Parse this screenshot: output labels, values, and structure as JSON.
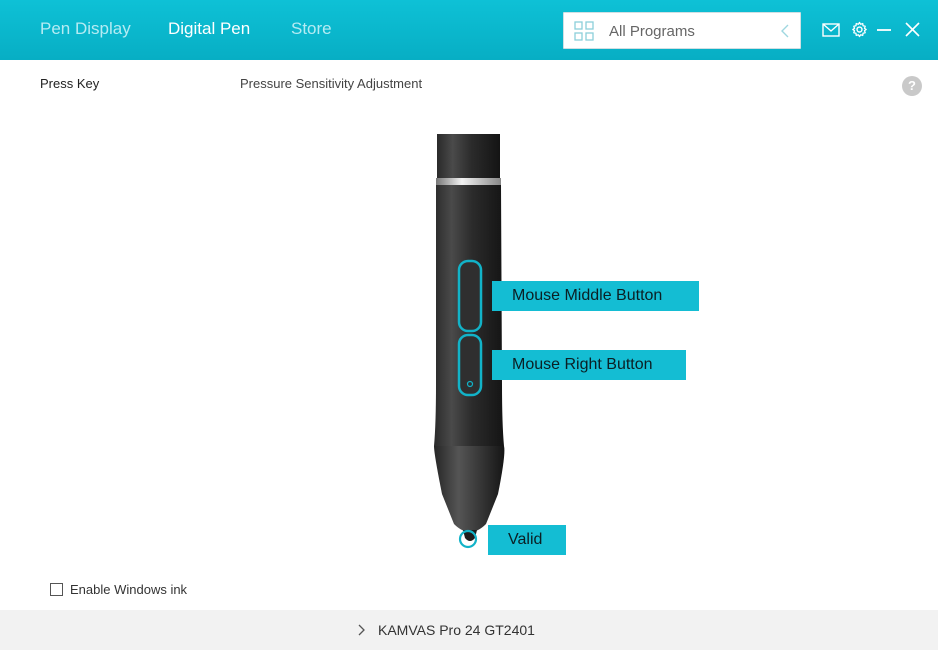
{
  "header": {
    "tabs": [
      {
        "label": "Pen Display",
        "active": false
      },
      {
        "label": "Digital Pen",
        "active": true
      },
      {
        "label": "Store",
        "active": false
      }
    ],
    "program_select": {
      "value": "All Programs"
    },
    "icons": [
      "mail-icon",
      "gear-icon",
      "minimize-icon",
      "close-icon"
    ]
  },
  "subtabs": {
    "press_key": "Press Key",
    "pressure": "Pressure Sensitivity Adjustment",
    "help": "?"
  },
  "pen": {
    "buttons": {
      "upper": "Mouse Middle Button",
      "lower": "Mouse Right Button",
      "tip": "Valid"
    }
  },
  "options": {
    "windows_ink": {
      "label": "Enable Windows ink",
      "checked": false
    }
  },
  "footer": {
    "device": "KAMVAS Pro 24 GT2401"
  },
  "colors": {
    "header": "#0ab8cd",
    "callout": "#14bdd3",
    "accent": "#12b3c8"
  }
}
